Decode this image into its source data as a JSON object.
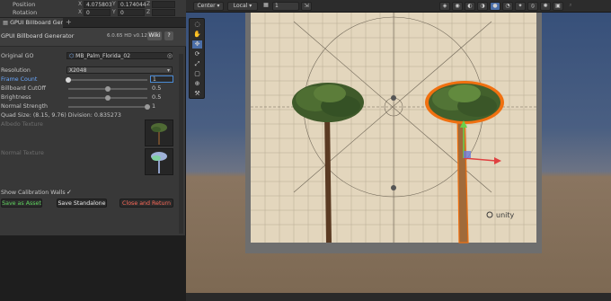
{
  "inspector": {
    "position_label": "Position",
    "rotation_label": "Rotation",
    "pos_x_axis": "X",
    "pos_x": "4.075803",
    "pos_y_axis": "Y",
    "pos_y": "0.174044",
    "pos_z_axis": "Z",
    "rot_x_axis": "X",
    "rot_x": "0",
    "rot_y_axis": "Y",
    "rot_y": "0",
    "rot_z_axis": "Z"
  },
  "window": {
    "tab_title": "GPUI Billboard Generator",
    "tab_add": "+",
    "header_title": "GPUI Billboard Generator",
    "version": "6.0.65 HD v0.12.11",
    "wiki_label": "Wiki",
    "help_label": "?"
  },
  "props": {
    "original_go_label": "Original GO",
    "original_go_value": "MB_Palm_Florida_02",
    "resolution_label": "Resolution",
    "resolution_value": "X2048",
    "frame_count_label": "Frame Count",
    "frame_count_value": "1",
    "frame_count_fraction": 0.0,
    "billboard_cutoff_label": "Billboard CutOff",
    "billboard_cutoff_value": "0.5",
    "brightness_label": "Brightness",
    "brightness_value": "0.5",
    "normal_strength_label": "Normal Strength",
    "normal_strength_value": "1",
    "quad_size_text": "Quad Size: (8.15, 9.76) Division: 0.835273",
    "albedo_label": "Albedo Texture",
    "normal_label": "Normal Texture",
    "calibration_label": "Show Calibration Walls",
    "calibration_check": "✓"
  },
  "buttons": {
    "save_asset": "Save as Asset",
    "save_standalone": "Save Standalone",
    "close_return": "Close and Return"
  },
  "scene_toolbar": {
    "pivot": "Center",
    "space": "Local",
    "snap": "1"
  },
  "colors": {
    "accent": "#4a8bd6",
    "save_asset_text": "#5fd35f",
    "close_text": "#ff6a5a",
    "selection_outline": "#f07010"
  },
  "watermark": "unity"
}
